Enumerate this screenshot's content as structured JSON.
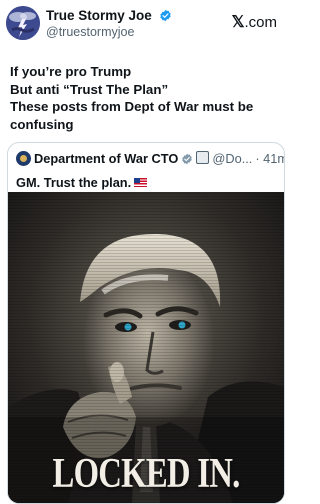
{
  "author": {
    "name": "True Stormy Joe",
    "handle": "@truestormyjoe"
  },
  "source": {
    "prefix": "𝕏",
    "domain": ".com"
  },
  "post": {
    "lines": [
      "If you’re pro Trump",
      "But anti “Trust The Plan”",
      "These posts from Dept of War must be",
      "confusing"
    ]
  },
  "quoted": {
    "name": "Department of War CTO",
    "handle": "@Do...",
    "time": "· 41m",
    "text": "GM. Trust the plan.",
    "image_caption": "LOCKED IN."
  },
  "colors": {
    "verified_blue": "#1d9bf0",
    "text_primary": "#0f1419",
    "text_secondary": "#536471",
    "border": "#cfd9de"
  },
  "icons": {
    "verified": "verified-badge-icon",
    "affiliate": "affiliate-badge-icon",
    "flag": "us-flag-emoji"
  }
}
